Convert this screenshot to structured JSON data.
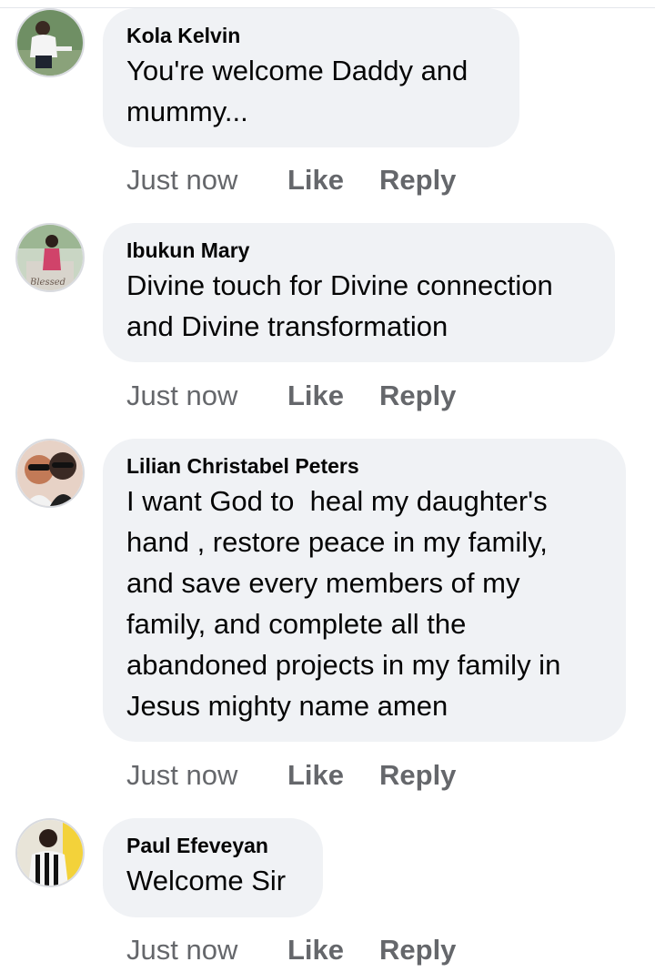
{
  "comments": [
    {
      "author": "Kola Kelvin",
      "text": "You're welcome Daddy and\nmummy...",
      "time": "Just now",
      "like_label": "Like",
      "reply_label": "Reply",
      "avatar_icon": "user-avatar-photo"
    },
    {
      "author": "Ibukun Mary",
      "text": "Divine touch for Divine connection\nand Divine transformation",
      "time": "Just now",
      "like_label": "Like",
      "reply_label": "Reply",
      "avatar_icon": "user-avatar-photo"
    },
    {
      "author": "Lilian Christabel Peters",
      "text": "I want God to  heal my daughter's\nhand , restore peace in my family,\nand save every members of my\nfamily, and complete all the\nabandoned projects in my family in\nJesus mighty name amen",
      "time": "Just now",
      "like_label": "Like",
      "reply_label": "Reply",
      "avatar_icon": "user-avatar-photo"
    },
    {
      "author": "Paul Efeveyan",
      "text": "Welcome Sir",
      "time": "Just now",
      "like_label": "Like",
      "reply_label": "Reply",
      "avatar_icon": "user-avatar-photo"
    }
  ],
  "colors": {
    "bubble": "#f0f2f5",
    "meta": "#65676b",
    "text": "#050505"
  }
}
